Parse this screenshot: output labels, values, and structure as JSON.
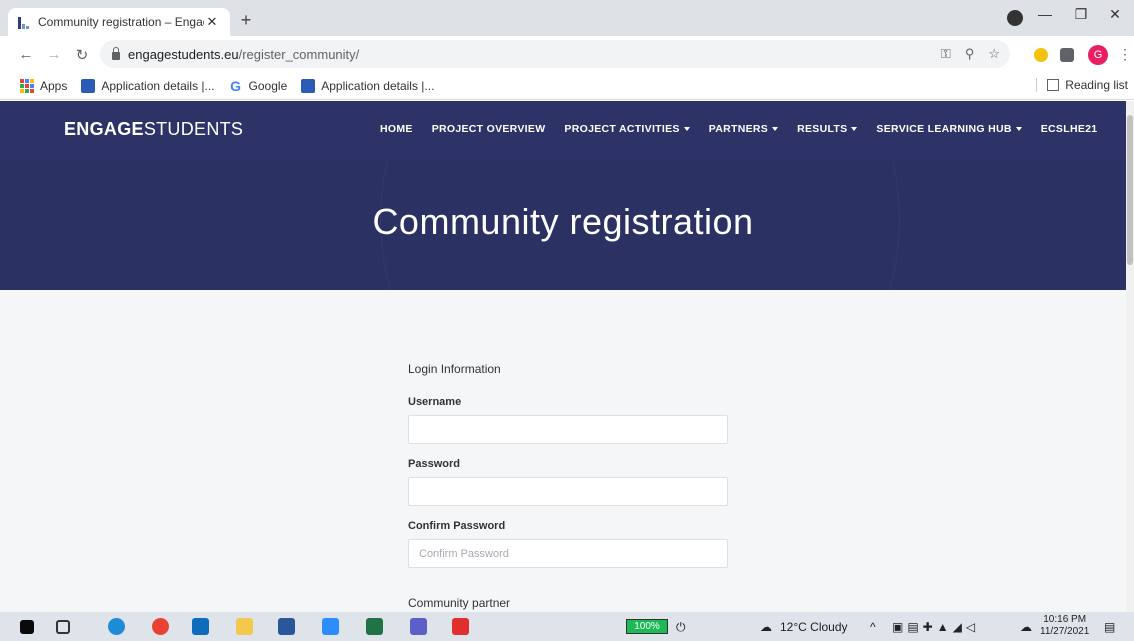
{
  "browser": {
    "tab_title": "Community registration – Engag",
    "tab_close": "✕",
    "new_tab": "+",
    "url_host": "engagestudents.eu",
    "url_path": "/register_community/",
    "profile_initial": "G"
  },
  "bookmarks": {
    "items": [
      {
        "label": "Apps",
        "icon": "apps-icon"
      },
      {
        "label": "Application details |...",
        "icon": "eu-flag-icon"
      },
      {
        "label": "Google",
        "icon": "google-icon"
      },
      {
        "label": "Application details |...",
        "icon": "eu-flag-icon"
      }
    ],
    "reading_list": "Reading list"
  },
  "site": {
    "logo_bold": "ENGAGE",
    "logo_light": "STUDENTS",
    "menu": [
      {
        "label": "HOME",
        "dropdown": false
      },
      {
        "label": "PROJECT OVERVIEW",
        "dropdown": false
      },
      {
        "label": "PROJECT ACTIVITIES",
        "dropdown": true
      },
      {
        "label": "PARTNERS",
        "dropdown": true
      },
      {
        "label": "RESULTS",
        "dropdown": true
      },
      {
        "label": "SERVICE LEARNING HUB",
        "dropdown": true
      },
      {
        "label": "ECSLHE21",
        "dropdown": false
      }
    ],
    "accent_color": "#2d3366"
  },
  "hero": {
    "title": "Community registration"
  },
  "form": {
    "section_title": "Login Information",
    "username": {
      "label": "Username",
      "value": "",
      "placeholder": ""
    },
    "password": {
      "label": "Password",
      "value": "",
      "placeholder": ""
    },
    "confirm_password": {
      "label": "Confirm Password",
      "value": "",
      "placeholder": "Confirm Password"
    },
    "next_section": "Community partner"
  },
  "taskbar": {
    "battery": "100%",
    "weather": "12°C  Cloudy",
    "time": "10:16 PM",
    "date": "11/27/2021"
  }
}
